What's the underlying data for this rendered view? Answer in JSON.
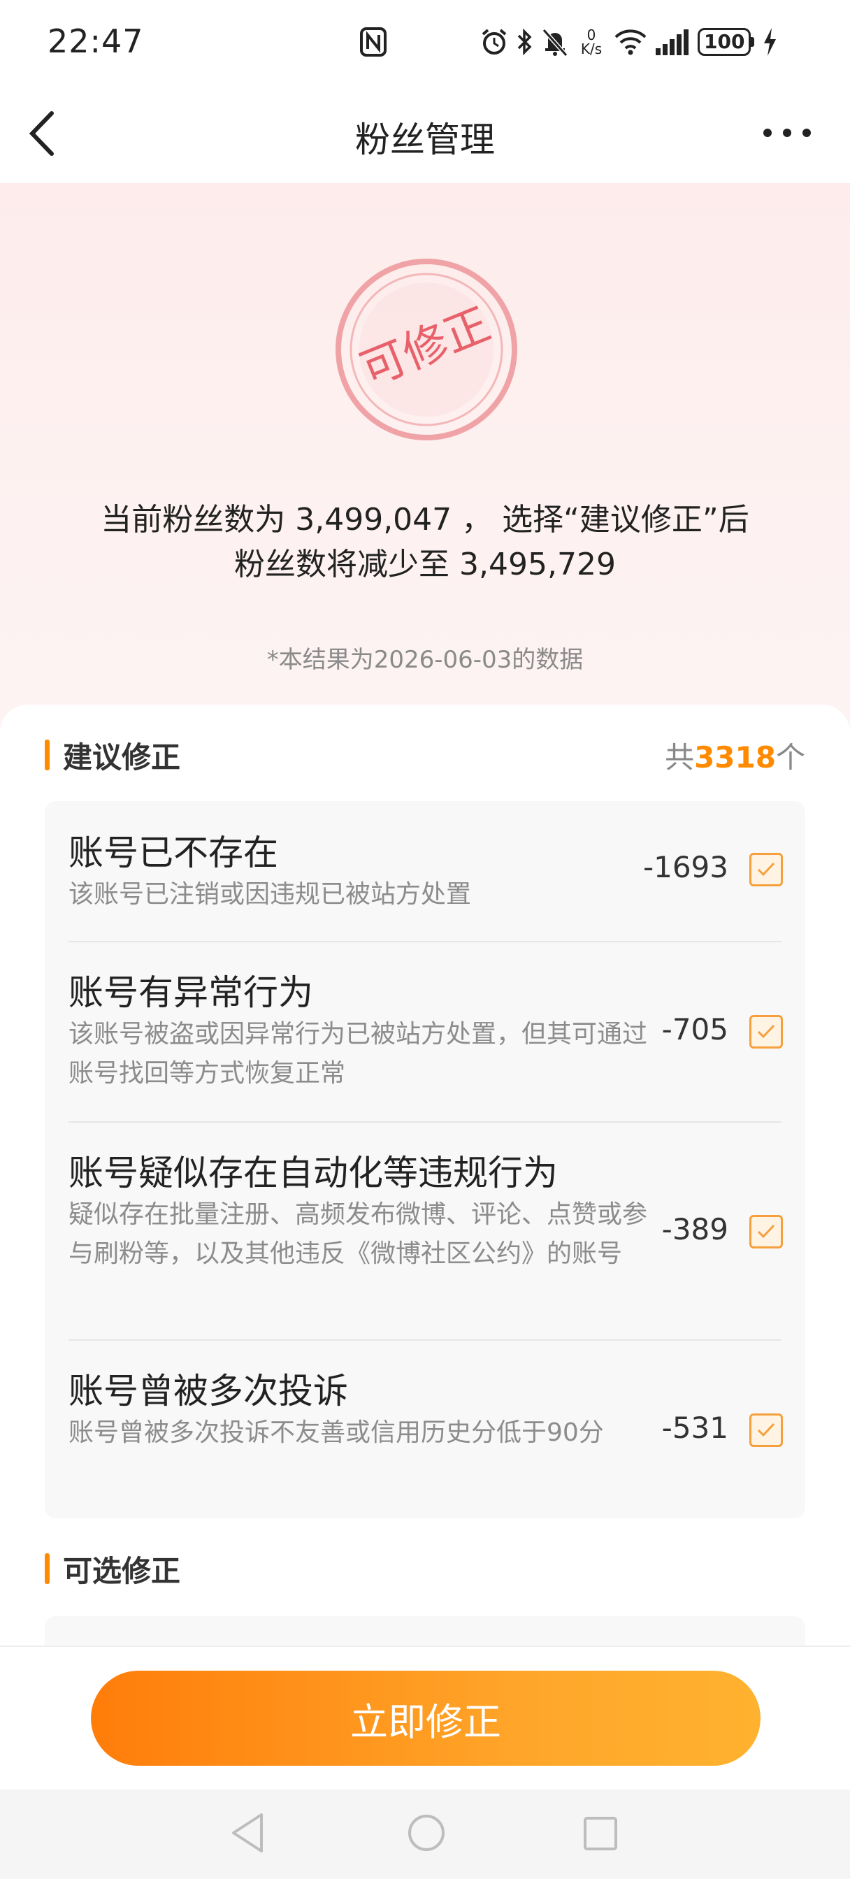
{
  "status_bar": {
    "time": "22:47",
    "netspeed_value": "0",
    "netspeed_unit": "K/s",
    "battery": "100"
  },
  "header": {
    "title": "粉丝管理"
  },
  "stamp": {
    "text": "可修正"
  },
  "summary": {
    "line1": "当前粉丝数为 3,499,047 ， 选择“建议修正”后",
    "line2": "粉丝数将减少至 3,495,729",
    "note": "*本结果为2026-06-03的数据"
  },
  "suggested": {
    "title": "建议修正",
    "count_prefix": "共",
    "count": "3318",
    "count_suffix": "个",
    "items": [
      {
        "title": "账号已不存在",
        "desc": "该账号已注销或因违规已被站方处置",
        "count": "-1693",
        "checked": true
      },
      {
        "title": "账号有异常行为",
        "desc": "该账号被盗或因异常行为已被站方处置，但其可通过账号找回等方式恢复正常",
        "count": "-705",
        "checked": true
      },
      {
        "title": "账号疑似存在自动化等违规行为",
        "desc": "疑似存在批量注册、高频发布微博、评论、点赞或参与刷粉等，以及其他违反《微博社区公约》的账号",
        "count": "-389",
        "checked": true
      },
      {
        "title": "账号曾被多次投诉",
        "desc": "账号曾被多次投诉不友善或信用历史分低于90分",
        "count": "-531",
        "checked": true
      }
    ]
  },
  "optional": {
    "title": "可选修正"
  },
  "action": {
    "button_label": "立即修正"
  },
  "colors": {
    "accent": "#ff8a00",
    "stamp_red": "#e8606a",
    "button_start": "#ff7d0a",
    "button_end": "#ffb22f"
  }
}
